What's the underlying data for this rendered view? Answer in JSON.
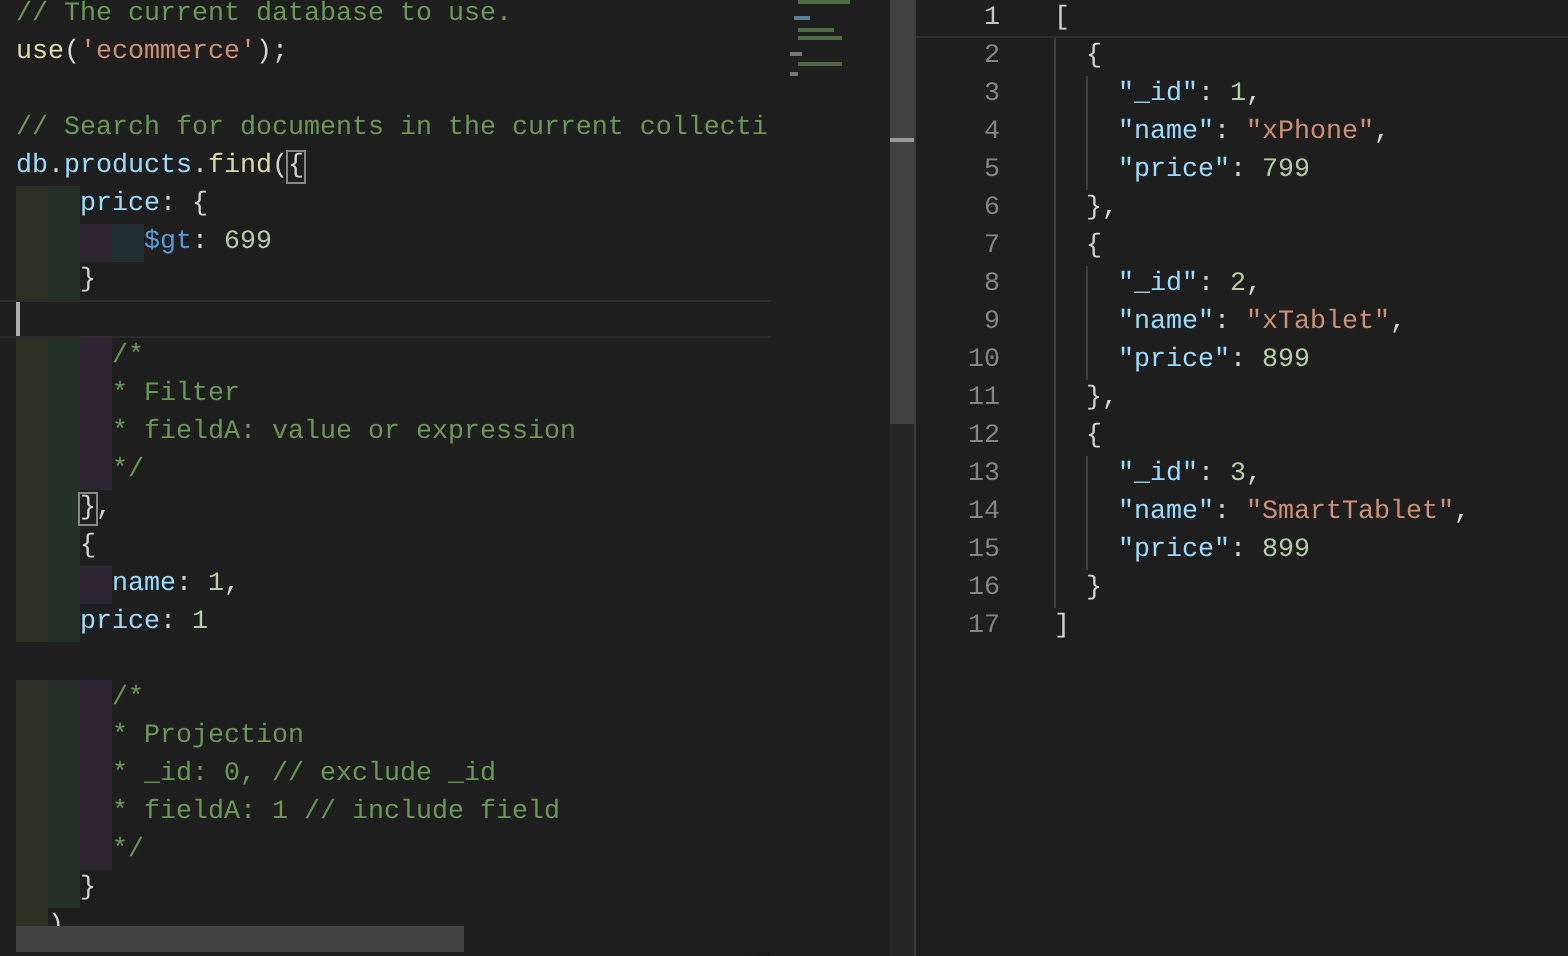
{
  "left_editor": {
    "lines": [
      {
        "current": false,
        "tokens": [
          {
            "kind": "comment",
            "text": "// The current database to use."
          }
        ]
      },
      {
        "current": false,
        "tokens": [
          {
            "kind": "function",
            "text": "use"
          },
          {
            "kind": "punct",
            "text": "("
          },
          {
            "kind": "string",
            "text": "'ecommerce'"
          },
          {
            "kind": "punct",
            "text": ");"
          }
        ]
      },
      {
        "current": false
      },
      {
        "current": false,
        "tokens": [
          {
            "kind": "comment",
            "text": "// Search for documents in the current collecti"
          }
        ]
      },
      {
        "current": false,
        "tokens": [
          {
            "kind": "ident",
            "text": "db"
          },
          {
            "kind": "punct",
            "text": "."
          },
          {
            "kind": "ident",
            "text": "products"
          },
          {
            "kind": "punct",
            "text": "."
          },
          {
            "kind": "function",
            "text": "find"
          },
          {
            "kind": "punct",
            "text": "("
          },
          {
            "kind": "match",
            "text": "{"
          }
        ]
      },
      {
        "current": false,
        "tokens": [
          {
            "kind": "ident",
            "text": "    price"
          },
          {
            "kind": "punct",
            "text": ": {"
          }
        ]
      },
      {
        "current": false,
        "tokens": [
          {
            "kind": "operator",
            "text": "        $gt"
          },
          {
            "kind": "punct",
            "text": ": "
          },
          {
            "kind": "number",
            "text": "699"
          }
        ]
      },
      {
        "current": false,
        "tokens": [
          {
            "kind": "punct",
            "text": "    }"
          }
        ]
      },
      {
        "current": true
      },
      {
        "current": false,
        "tokens": [
          {
            "kind": "comment",
            "text": "      /*"
          }
        ]
      },
      {
        "current": false,
        "tokens": [
          {
            "kind": "comment",
            "text": "      * Filter"
          }
        ]
      },
      {
        "current": false,
        "tokens": [
          {
            "kind": "comment",
            "text": "      * fieldA: value or expression"
          }
        ]
      },
      {
        "current": false,
        "tokens": [
          {
            "kind": "comment",
            "text": "      */"
          }
        ]
      },
      {
        "current": false,
        "tokens": [
          {
            "kind": "match",
            "text": "    }"
          },
          {
            "kind": "punct",
            "text": ","
          }
        ]
      },
      {
        "current": false,
        "tokens": [
          {
            "kind": "punct",
            "text": "    {"
          }
        ]
      },
      {
        "current": false,
        "tokens": [
          {
            "kind": "ident",
            "text": "      name"
          },
          {
            "kind": "punct",
            "text": ": "
          },
          {
            "kind": "number",
            "text": "1"
          },
          {
            "kind": "punct",
            "text": ","
          }
        ]
      },
      {
        "current": false,
        "tokens": [
          {
            "kind": "ident",
            "text": "    price"
          },
          {
            "kind": "punct",
            "text": ": "
          },
          {
            "kind": "number",
            "text": "1"
          }
        ]
      },
      {
        "current": false
      },
      {
        "current": false,
        "tokens": [
          {
            "kind": "comment",
            "text": "      /*"
          }
        ]
      },
      {
        "current": false,
        "tokens": [
          {
            "kind": "comment",
            "text": "      * Projection"
          }
        ]
      },
      {
        "current": false,
        "tokens": [
          {
            "kind": "comment",
            "text": "      * _id: 0, // exclude _id"
          }
        ]
      },
      {
        "current": false,
        "tokens": [
          {
            "kind": "comment",
            "text": "      * fieldA: 1 // include field"
          }
        ]
      },
      {
        "current": false,
        "tokens": [
          {
            "kind": "comment",
            "text": "      */"
          }
        ]
      },
      {
        "current": false,
        "tokens": [
          {
            "kind": "punct",
            "text": "    }"
          }
        ]
      },
      {
        "current": false,
        "tokens": [
          {
            "kind": "punct",
            "text": "  )"
          }
        ]
      }
    ]
  },
  "right_editor": {
    "lines": [
      {
        "number": "1",
        "current": true,
        "tokens": [
          {
            "kind": "punct",
            "text": "["
          }
        ]
      },
      {
        "number": "2",
        "current": false,
        "tokens": [
          {
            "kind": "punct",
            "text": "  {"
          }
        ]
      },
      {
        "number": "3",
        "current": false,
        "tokens": [
          {
            "kind": "ident",
            "text": "    \"_id\""
          },
          {
            "kind": "punct",
            "text": ": "
          },
          {
            "kind": "number",
            "text": "1"
          },
          {
            "kind": "punct",
            "text": ","
          }
        ]
      },
      {
        "number": "4",
        "current": false,
        "tokens": [
          {
            "kind": "ident",
            "text": "    \"name\""
          },
          {
            "kind": "punct",
            "text": ": "
          },
          {
            "kind": "string",
            "text": "\"xPhone\""
          },
          {
            "kind": "punct",
            "text": ","
          }
        ]
      },
      {
        "number": "5",
        "current": false,
        "tokens": [
          {
            "kind": "ident",
            "text": "    \"price\""
          },
          {
            "kind": "punct",
            "text": ": "
          },
          {
            "kind": "number",
            "text": "799"
          }
        ]
      },
      {
        "number": "6",
        "current": false,
        "tokens": [
          {
            "kind": "punct",
            "text": "  },"
          }
        ]
      },
      {
        "number": "7",
        "current": false,
        "tokens": [
          {
            "kind": "punct",
            "text": "  {"
          }
        ]
      },
      {
        "number": "8",
        "current": false,
        "tokens": [
          {
            "kind": "ident",
            "text": "    \"_id\""
          },
          {
            "kind": "punct",
            "text": ": "
          },
          {
            "kind": "number",
            "text": "2"
          },
          {
            "kind": "punct",
            "text": ","
          }
        ]
      },
      {
        "number": "9",
        "current": false,
        "tokens": [
          {
            "kind": "ident",
            "text": "    \"name\""
          },
          {
            "kind": "punct",
            "text": ": "
          },
          {
            "kind": "string",
            "text": "\"xTablet\""
          },
          {
            "kind": "punct",
            "text": ","
          }
        ]
      },
      {
        "number": "10",
        "current": false,
        "tokens": [
          {
            "kind": "ident",
            "text": "    \"price\""
          },
          {
            "kind": "punct",
            "text": ": "
          },
          {
            "kind": "number",
            "text": "899"
          }
        ]
      },
      {
        "number": "11",
        "current": false,
        "tokens": [
          {
            "kind": "punct",
            "text": "  },"
          }
        ]
      },
      {
        "number": "12",
        "current": false,
        "tokens": [
          {
            "kind": "punct",
            "text": "  {"
          }
        ]
      },
      {
        "number": "13",
        "current": false,
        "tokens": [
          {
            "kind": "ident",
            "text": "    \"_id\""
          },
          {
            "kind": "punct",
            "text": ": "
          },
          {
            "kind": "number",
            "text": "3"
          },
          {
            "kind": "punct",
            "text": ","
          }
        ]
      },
      {
        "number": "14",
        "current": false,
        "tokens": [
          {
            "kind": "ident",
            "text": "    \"name\""
          },
          {
            "kind": "punct",
            "text": ": "
          },
          {
            "kind": "string",
            "text": "\"SmartTablet\""
          },
          {
            "kind": "punct",
            "text": ","
          }
        ]
      },
      {
        "number": "15",
        "current": false,
        "tokens": [
          {
            "kind": "ident",
            "text": "    \"price\""
          },
          {
            "kind": "punct",
            "text": ": "
          },
          {
            "kind": "number",
            "text": "899"
          }
        ]
      },
      {
        "number": "16",
        "current": false,
        "tokens": [
          {
            "kind": "punct",
            "text": "  }"
          }
        ]
      },
      {
        "number": "17",
        "current": false,
        "tokens": [
          {
            "kind": "punct",
            "text": "]"
          }
        ]
      }
    ]
  }
}
